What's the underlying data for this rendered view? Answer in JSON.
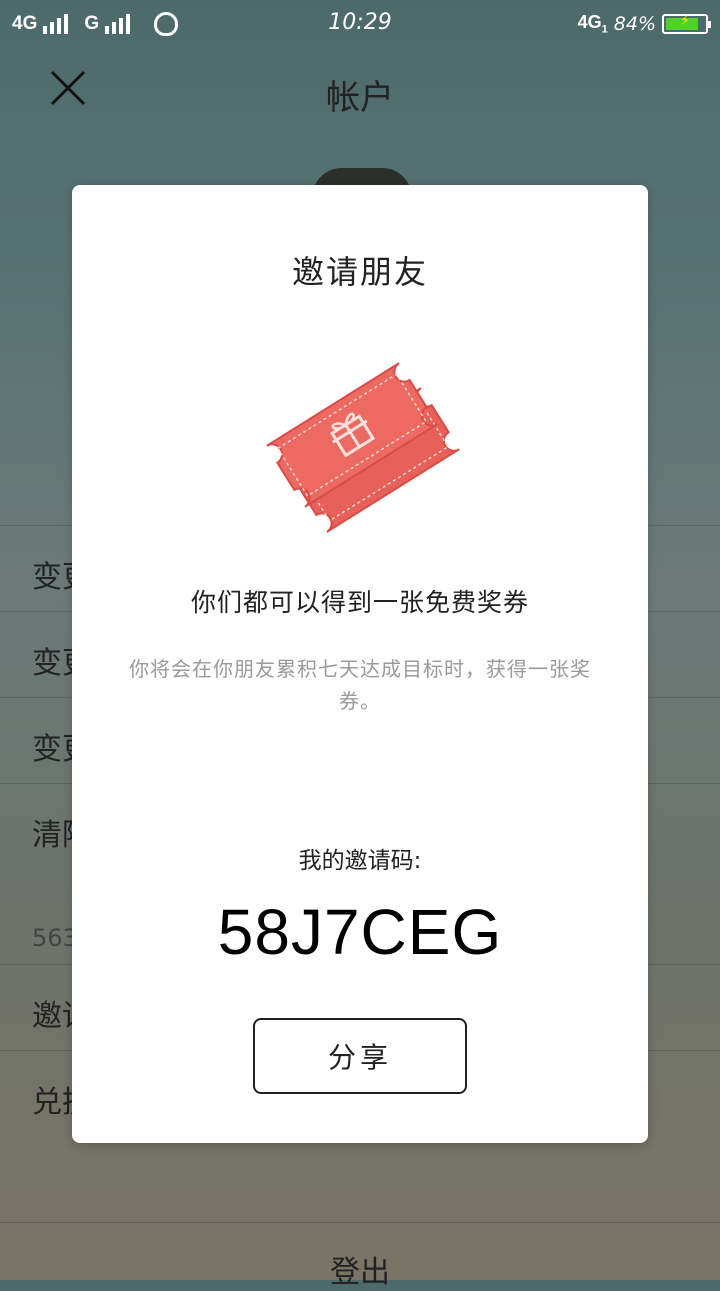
{
  "status_bar": {
    "network_1": "4G",
    "network_2": "G",
    "time": "10:29",
    "network_right": "4G",
    "sim_index": "1",
    "battery_percent": "84%",
    "battery_level": 0.84,
    "battery_color": "#4fd12a"
  },
  "header": {
    "title": "帐户",
    "close_icon": "close-icon"
  },
  "background_list": {
    "items": [
      "变更",
      "变更",
      "变更",
      "清除",
      "563",
      "邀请",
      "兑换"
    ],
    "logout_label": "登出"
  },
  "modal": {
    "title": "邀请朋友",
    "ticket_icon": "gift-ticket-icon",
    "ticket_color": "#e8605a",
    "headline": "你们都可以得到一张免费奖券",
    "description": "你将会在你朋友累积七天达成目标时，获得一张奖券。",
    "code_label": "我的邀请码:",
    "invite_code": "58J7CEG",
    "share_label": "分享"
  }
}
